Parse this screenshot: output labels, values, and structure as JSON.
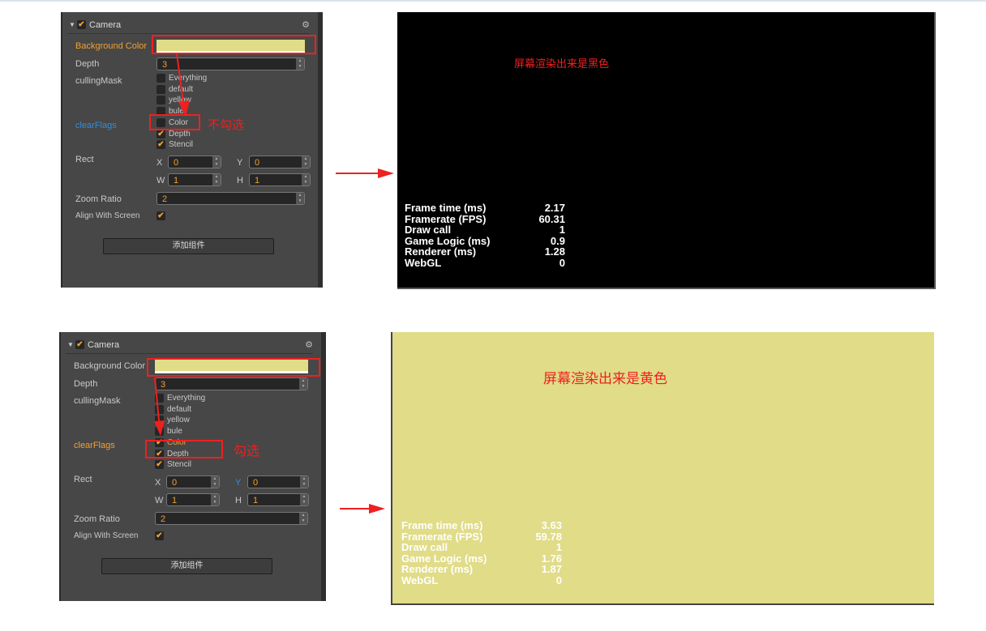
{
  "panels": [
    {
      "inspector": {
        "component": "Camera",
        "enabled": true,
        "background_color_label": "Background Color",
        "background_color": "#e0dc88",
        "depth_label": "Depth",
        "depth": "3",
        "culling_mask_label": "cullingMask",
        "culling_mask": [
          {
            "label": "Everything",
            "checked": false
          },
          {
            "label": "default",
            "checked": false
          },
          {
            "label": "yellow",
            "checked": false
          },
          {
            "label": "bule",
            "checked": false
          }
        ],
        "clear_flags_label": "clearFlags",
        "clear_flags": [
          {
            "label": "Color",
            "checked": false
          },
          {
            "label": "Depth",
            "checked": true
          },
          {
            "label": "Stencil",
            "checked": true
          }
        ],
        "rect_label": "Rect",
        "x_label": "X",
        "x": "0",
        "y_label": "Y",
        "y": "0",
        "w_label": "W",
        "w": "1",
        "h_label": "H",
        "h": "1",
        "zoom_ratio_label": "Zoom Ratio",
        "zoom_ratio": "2",
        "align_label": "Align With Screen",
        "align": true,
        "add_component": "添加组件"
      },
      "annotation": "不勾选",
      "screen": {
        "background": "#000000",
        "caption": "屏幕渲染出来是黑色",
        "stats_color": "#ffffff",
        "stats": [
          {
            "k": "Frame time (ms)",
            "v": "2.17"
          },
          {
            "k": "Framerate (FPS)",
            "v": "60.31"
          },
          {
            "k": "Draw call",
            "v": "1"
          },
          {
            "k": "Game Logic (ms)",
            "v": "0.9"
          },
          {
            "k": "Renderer (ms)",
            "v": "1.28"
          },
          {
            "k": "WebGL",
            "v": "0"
          }
        ]
      }
    },
    {
      "inspector": {
        "component": "Camera",
        "enabled": true,
        "background_color_label": "Background Color",
        "background_color": "#e0dc88",
        "depth_label": "Depth",
        "depth": "3",
        "culling_mask_label": "cullingMask",
        "culling_mask": [
          {
            "label": "Everything",
            "checked": false
          },
          {
            "label": "default",
            "checked": false
          },
          {
            "label": "yellow",
            "checked": false
          },
          {
            "label": "bule",
            "checked": false
          }
        ],
        "clear_flags_label": "clearFlags",
        "clear_flags": [
          {
            "label": "Color",
            "checked": true
          },
          {
            "label": "Depth",
            "checked": true
          },
          {
            "label": "Stencil",
            "checked": true
          }
        ],
        "rect_label": "Rect",
        "x_label": "X",
        "x": "0",
        "y_label": "Y",
        "y": "0",
        "w_label": "W",
        "w": "1",
        "h_label": "H",
        "h": "1",
        "zoom_ratio_label": "Zoom Ratio",
        "zoom_ratio": "2",
        "align_label": "Align With Screen",
        "align": true,
        "add_component": "添加组件"
      },
      "annotation": "勾选",
      "screen": {
        "background": "#e0dc88",
        "caption": "屏幕渲染出来是黄色",
        "stats_color": "#ffffff",
        "stats": [
          {
            "k": "Frame time (ms)",
            "v": "3.63"
          },
          {
            "k": "Framerate (FPS)",
            "v": "59.78"
          },
          {
            "k": "Draw call",
            "v": "1"
          },
          {
            "k": "Game Logic (ms)",
            "v": "1.76"
          },
          {
            "k": "Renderer (ms)",
            "v": "1.87"
          },
          {
            "k": "WebGL",
            "v": "0"
          }
        ]
      }
    }
  ]
}
